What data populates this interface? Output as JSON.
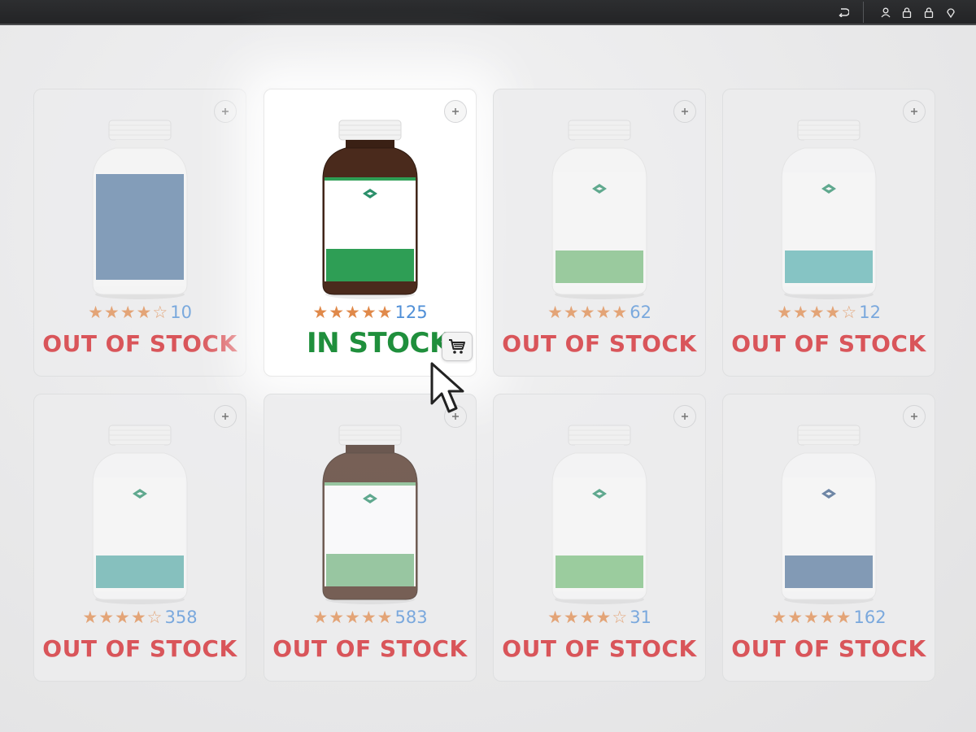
{
  "toolbar": {
    "icons": [
      "back-icon",
      "user-icon",
      "lock-icon",
      "lock-icon",
      "pin-icon"
    ]
  },
  "products": [
    {
      "rating_stars": "★★★★☆",
      "review_count": "10",
      "stock_label": "OUT OF STOCK",
      "in_stock": false,
      "bottle": "white",
      "label_color": "#5b7fa6"
    },
    {
      "rating_stars": "★★★★★",
      "review_count": "125",
      "stock_label": "IN STOCK",
      "in_stock": true,
      "bottle": "amber",
      "label_color": "#2e9e55"
    },
    {
      "rating_stars": "★★★★★",
      "review_count": "62",
      "stock_label": "OUT OF STOCK",
      "in_stock": false,
      "bottle": "white",
      "label_color": "#7bbd80"
    },
    {
      "rating_stars": "★★★★☆",
      "review_count": "12",
      "stock_label": "OUT OF STOCK",
      "in_stock": false,
      "bottle": "white",
      "label_color": "#5fb5b5"
    },
    {
      "rating_stars": "★★★★☆",
      "review_count": "358",
      "stock_label": "OUT OF STOCK",
      "in_stock": false,
      "bottle": "white",
      "label_color": "#5fb0ad"
    },
    {
      "rating_stars": "★★★★★",
      "review_count": "583",
      "stock_label": "OUT OF STOCK",
      "in_stock": false,
      "bottle": "amber",
      "label_color": "#78b884"
    },
    {
      "rating_stars": "★★★★☆",
      "review_count": "31",
      "stock_label": "OUT OF STOCK",
      "in_stock": false,
      "bottle": "white",
      "label_color": "#7cc080"
    },
    {
      "rating_stars": "★★★★★",
      "review_count": "162",
      "stock_label": "OUT OF STOCK",
      "in_stock": false,
      "bottle": "white",
      "label_color": "#5a7ba0"
    }
  ],
  "colors": {
    "out_of_stock": "#d9555a",
    "in_stock": "#1f8f3c",
    "stars": "#e0894a",
    "review_count": "#4f8fd7"
  }
}
